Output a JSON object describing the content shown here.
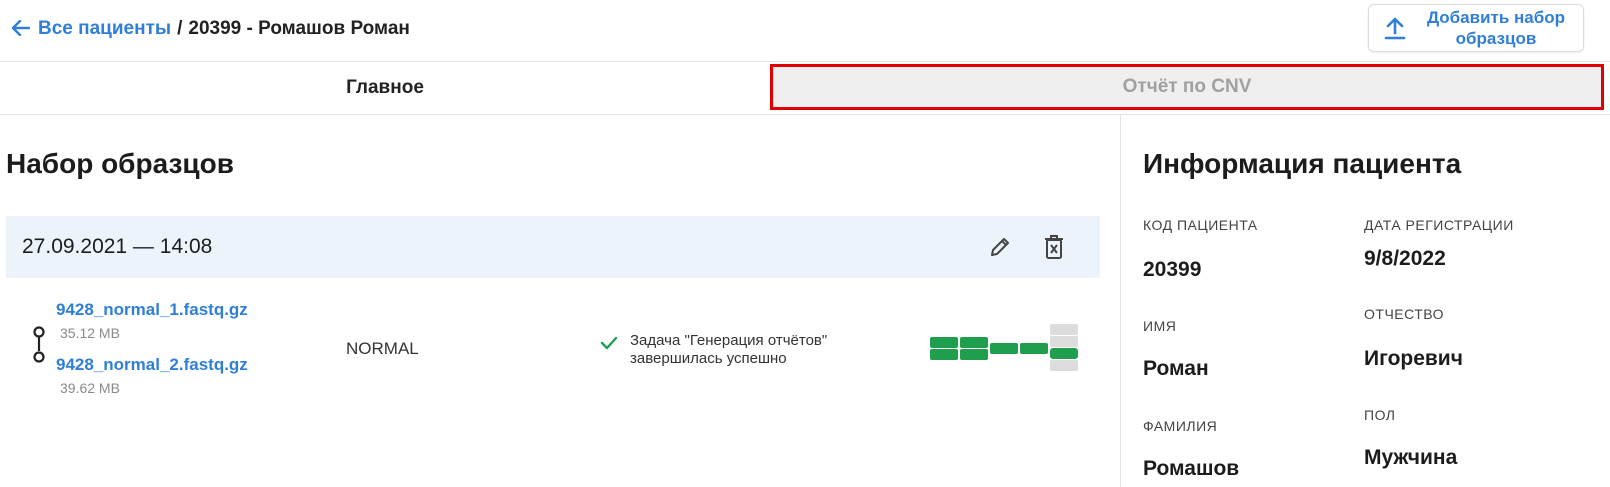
{
  "header": {
    "back_link": "Все пациенты",
    "separator": "/",
    "current": "20399 - Ромашов Роман",
    "add_button_label": "Добавить набор\nобразцов"
  },
  "tabs": [
    {
      "label": "Главное",
      "active": false
    },
    {
      "label": "Отчёт по CNV",
      "active": true
    }
  ],
  "sample_sets": {
    "title": "Набор образцов",
    "items": [
      {
        "datetime": "27.09.2021 — 14:08",
        "files": [
          {
            "name": "9428_normal_1.fastq.gz",
            "size": "35.12 MB"
          },
          {
            "name": "9428_normal_2.fastq.gz",
            "size": "39.62 MB"
          }
        ],
        "type": "NORMAL",
        "status_text": "Задача \"Генерация отчётов\"\nзавершилась успешно",
        "status_color": "#1f9e4d",
        "progress_color": "#1f9e4d",
        "pending_color": "#dcdcdc"
      }
    ]
  },
  "patient_info": {
    "title": "Информация пациента",
    "fields": {
      "code": {
        "label": "КОД ПАЦИЕНТА",
        "value": "20399"
      },
      "registration_date": {
        "label": "ДАТА РЕГИСТРАЦИИ",
        "value": "9/8/2022"
      },
      "first_name": {
        "label": "ИМЯ",
        "value": "Роман"
      },
      "patronymic": {
        "label": "ОТЧЕСТВО",
        "value": "Игоревич"
      },
      "last_name": {
        "label": "ФАМИЛИЯ",
        "value": "Ромашов"
      },
      "sex": {
        "label": "ПОЛ",
        "value": "Мужчина"
      }
    }
  },
  "colors": {
    "accent": "#2f7fd9",
    "tab_highlight_border": "#e00000",
    "set_header_bg": "#edf3fb"
  }
}
